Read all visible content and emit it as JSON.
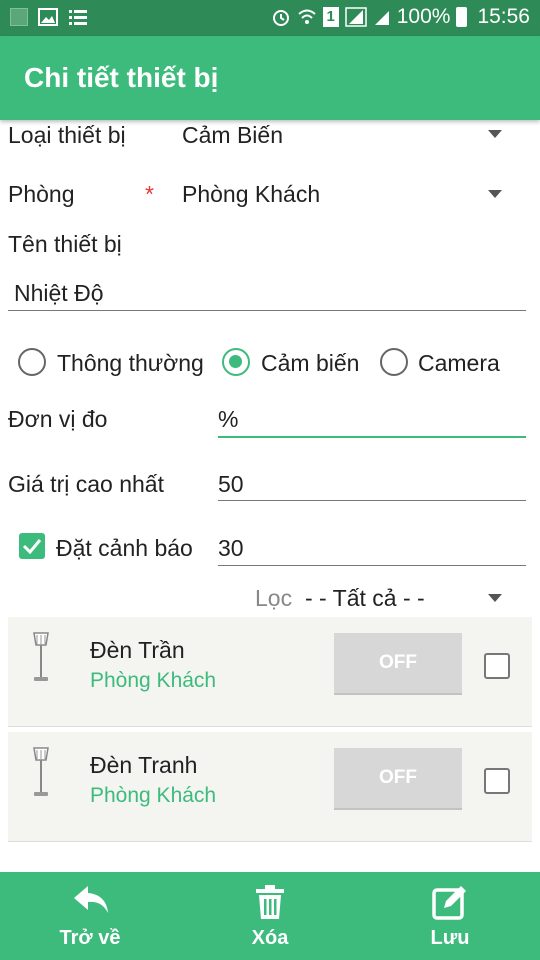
{
  "status_bar": {
    "battery": "100%",
    "time": "15:56",
    "sim": "1"
  },
  "app_bar": {
    "title": "Chi tiết thiết bị"
  },
  "form": {
    "device_type": {
      "label": "Loại thiết bị",
      "value": "Cảm Biến"
    },
    "room": {
      "label": "Phòng",
      "required_mark": "*",
      "value": "Phòng Khách"
    },
    "device_name": {
      "label": "Tên thiết bị",
      "value": "Nhiệt Độ"
    },
    "kind_options": [
      {
        "label": "Thông thường",
        "selected": false
      },
      {
        "label": "Cảm biến",
        "selected": true
      },
      {
        "label": "Camera",
        "selected": false
      }
    ],
    "unit": {
      "label": "Đơn vị đo",
      "value": "%"
    },
    "max_value": {
      "label": "Giá trị cao nhất",
      "value": "50"
    },
    "alert": {
      "label": "Đặt cảnh báo",
      "checked": true,
      "value": "30"
    },
    "filter": {
      "label": "Lọc",
      "value": "- - Tất cả - -"
    }
  },
  "devices": [
    {
      "name": "Đèn Trần",
      "room": "Phòng Khách",
      "state": "OFF",
      "checked": false
    },
    {
      "name": "Đèn Tranh",
      "room": "Phòng Khách",
      "state": "OFF",
      "checked": false
    }
  ],
  "bottom_bar": {
    "back": "Trở về",
    "delete": "Xóa",
    "save": "Lưu"
  },
  "colors": {
    "primary": "#3dbb7d",
    "status_bar": "#2e8b57",
    "required": "#e53935",
    "off_button": "#d7d7d7"
  }
}
